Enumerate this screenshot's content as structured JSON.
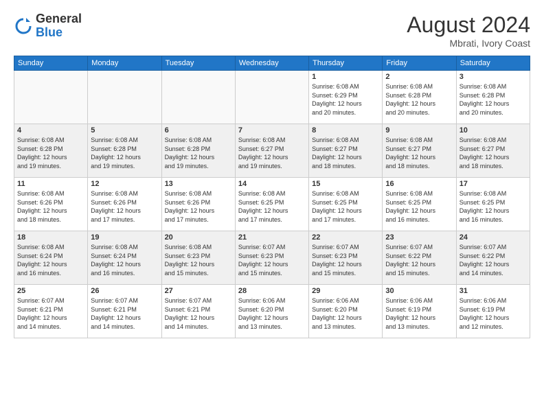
{
  "header": {
    "logo_line1": "General",
    "logo_line2": "Blue",
    "month_year": "August 2024",
    "location": "Mbrati, Ivory Coast"
  },
  "weekdays": [
    "Sunday",
    "Monday",
    "Tuesday",
    "Wednesday",
    "Thursday",
    "Friday",
    "Saturday"
  ],
  "weeks": [
    [
      {
        "day": "",
        "info": ""
      },
      {
        "day": "",
        "info": ""
      },
      {
        "day": "",
        "info": ""
      },
      {
        "day": "",
        "info": ""
      },
      {
        "day": "1",
        "info": "Sunrise: 6:08 AM\nSunset: 6:29 PM\nDaylight: 12 hours\nand 20 minutes."
      },
      {
        "day": "2",
        "info": "Sunrise: 6:08 AM\nSunset: 6:28 PM\nDaylight: 12 hours\nand 20 minutes."
      },
      {
        "day": "3",
        "info": "Sunrise: 6:08 AM\nSunset: 6:28 PM\nDaylight: 12 hours\nand 20 minutes."
      }
    ],
    [
      {
        "day": "4",
        "info": "Sunrise: 6:08 AM\nSunset: 6:28 PM\nDaylight: 12 hours\nand 19 minutes."
      },
      {
        "day": "5",
        "info": "Sunrise: 6:08 AM\nSunset: 6:28 PM\nDaylight: 12 hours\nand 19 minutes."
      },
      {
        "day": "6",
        "info": "Sunrise: 6:08 AM\nSunset: 6:28 PM\nDaylight: 12 hours\nand 19 minutes."
      },
      {
        "day": "7",
        "info": "Sunrise: 6:08 AM\nSunset: 6:27 PM\nDaylight: 12 hours\nand 19 minutes."
      },
      {
        "day": "8",
        "info": "Sunrise: 6:08 AM\nSunset: 6:27 PM\nDaylight: 12 hours\nand 18 minutes."
      },
      {
        "day": "9",
        "info": "Sunrise: 6:08 AM\nSunset: 6:27 PM\nDaylight: 12 hours\nand 18 minutes."
      },
      {
        "day": "10",
        "info": "Sunrise: 6:08 AM\nSunset: 6:27 PM\nDaylight: 12 hours\nand 18 minutes."
      }
    ],
    [
      {
        "day": "11",
        "info": "Sunrise: 6:08 AM\nSunset: 6:26 PM\nDaylight: 12 hours\nand 18 minutes."
      },
      {
        "day": "12",
        "info": "Sunrise: 6:08 AM\nSunset: 6:26 PM\nDaylight: 12 hours\nand 17 minutes."
      },
      {
        "day": "13",
        "info": "Sunrise: 6:08 AM\nSunset: 6:26 PM\nDaylight: 12 hours\nand 17 minutes."
      },
      {
        "day": "14",
        "info": "Sunrise: 6:08 AM\nSunset: 6:25 PM\nDaylight: 12 hours\nand 17 minutes."
      },
      {
        "day": "15",
        "info": "Sunrise: 6:08 AM\nSunset: 6:25 PM\nDaylight: 12 hours\nand 17 minutes."
      },
      {
        "day": "16",
        "info": "Sunrise: 6:08 AM\nSunset: 6:25 PM\nDaylight: 12 hours\nand 16 minutes."
      },
      {
        "day": "17",
        "info": "Sunrise: 6:08 AM\nSunset: 6:25 PM\nDaylight: 12 hours\nand 16 minutes."
      }
    ],
    [
      {
        "day": "18",
        "info": "Sunrise: 6:08 AM\nSunset: 6:24 PM\nDaylight: 12 hours\nand 16 minutes."
      },
      {
        "day": "19",
        "info": "Sunrise: 6:08 AM\nSunset: 6:24 PM\nDaylight: 12 hours\nand 16 minutes."
      },
      {
        "day": "20",
        "info": "Sunrise: 6:08 AM\nSunset: 6:23 PM\nDaylight: 12 hours\nand 15 minutes."
      },
      {
        "day": "21",
        "info": "Sunrise: 6:07 AM\nSunset: 6:23 PM\nDaylight: 12 hours\nand 15 minutes."
      },
      {
        "day": "22",
        "info": "Sunrise: 6:07 AM\nSunset: 6:23 PM\nDaylight: 12 hours\nand 15 minutes."
      },
      {
        "day": "23",
        "info": "Sunrise: 6:07 AM\nSunset: 6:22 PM\nDaylight: 12 hours\nand 15 minutes."
      },
      {
        "day": "24",
        "info": "Sunrise: 6:07 AM\nSunset: 6:22 PM\nDaylight: 12 hours\nand 14 minutes."
      }
    ],
    [
      {
        "day": "25",
        "info": "Sunrise: 6:07 AM\nSunset: 6:21 PM\nDaylight: 12 hours\nand 14 minutes."
      },
      {
        "day": "26",
        "info": "Sunrise: 6:07 AM\nSunset: 6:21 PM\nDaylight: 12 hours\nand 14 minutes."
      },
      {
        "day": "27",
        "info": "Sunrise: 6:07 AM\nSunset: 6:21 PM\nDaylight: 12 hours\nand 14 minutes."
      },
      {
        "day": "28",
        "info": "Sunrise: 6:06 AM\nSunset: 6:20 PM\nDaylight: 12 hours\nand 13 minutes."
      },
      {
        "day": "29",
        "info": "Sunrise: 6:06 AM\nSunset: 6:20 PM\nDaylight: 12 hours\nand 13 minutes."
      },
      {
        "day": "30",
        "info": "Sunrise: 6:06 AM\nSunset: 6:19 PM\nDaylight: 12 hours\nand 13 minutes."
      },
      {
        "day": "31",
        "info": "Sunrise: 6:06 AM\nSunset: 6:19 PM\nDaylight: 12 hours\nand 12 minutes."
      }
    ]
  ]
}
